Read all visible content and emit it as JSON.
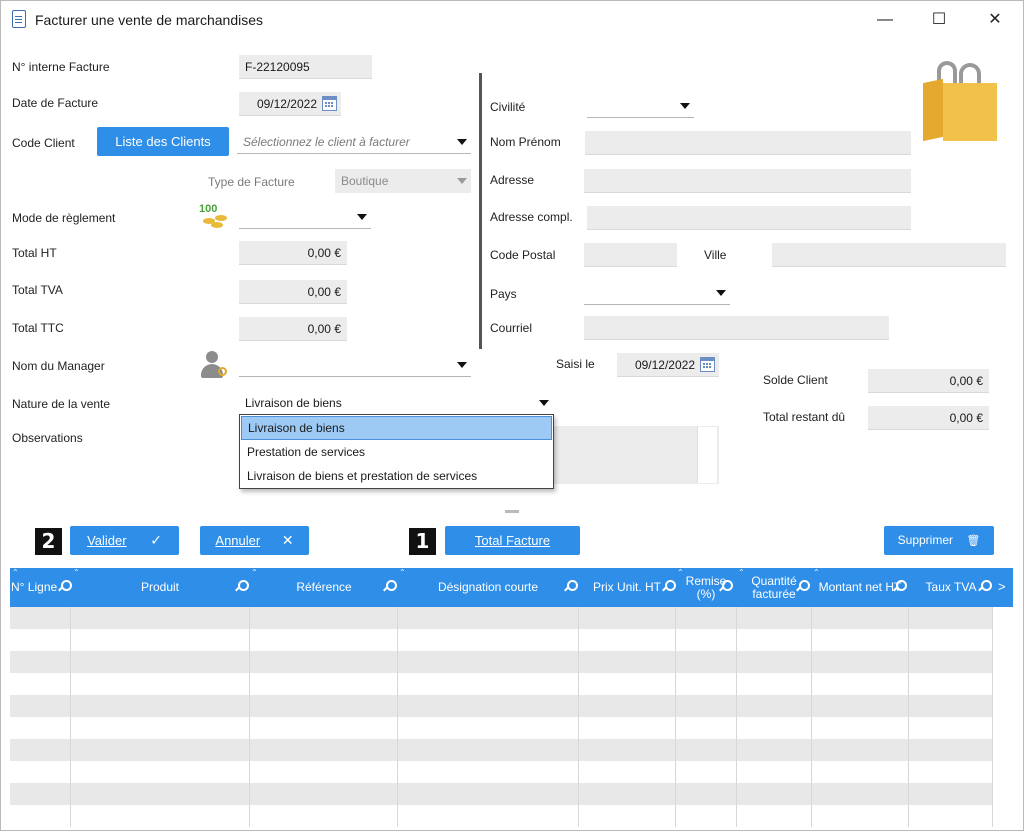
{
  "window": {
    "title": "Facturer une vente de marchandises",
    "minimize": "—",
    "maximize": "☐",
    "close": "✕"
  },
  "form": {
    "num_facture_label": "N° interne Facture",
    "num_facture_value": "F-22120095",
    "date_facture_label": "Date de Facture",
    "date_facture_value": "09/12/2022",
    "code_client_label": "Code Client",
    "liste_clients_button": "Liste des Clients",
    "client_placeholder": "Sélectionnez le client à facturer",
    "type_facture_label": "Type de Facture",
    "type_facture_value": "Boutique",
    "mode_reglement_label": "Mode de règlement",
    "mode_reglement_value": "",
    "total_ht_label": "Total HT",
    "total_ht_value": "0,00 €",
    "total_tva_label": "Total TVA",
    "total_tva_value": "0,00 €",
    "total_ttc_label": "Total TTC",
    "total_ttc_value": "0,00 €",
    "manager_label": "Nom du Manager",
    "manager_value": "",
    "nature_label": "Nature de la vente",
    "nature_value": "Livraison de biens",
    "observations_label": "Observations",
    "money_icon_text": "100"
  },
  "nature_options": [
    "Livraison de biens",
    "Prestation de services",
    "Livraison de biens et prestation de services"
  ],
  "client": {
    "civilite_label": "Civilité",
    "civilite_value": "",
    "nom_label": "Nom Prénom",
    "adresse_label": "Adresse",
    "adresse_compl_label": "Adresse compl.",
    "code_postal_label": "Code Postal",
    "ville_label": "Ville",
    "pays_label": "Pays",
    "pays_value": "",
    "courriel_label": "Courriel",
    "saisi_label": "Saisi le",
    "saisi_value": "09/12/2022",
    "solde_label": "Solde Client",
    "solde_value": "0,00 €",
    "restant_label": "Total restant dû",
    "restant_value": "0,00 €"
  },
  "actions": {
    "badge_2": "2",
    "valider": "Valider",
    "annuler": "Annuler",
    "badge_1": "1",
    "total_facture": "Total Facture",
    "supprimer": "Supprimer"
  },
  "grid": {
    "columns": [
      "N° Ligne",
      "Produit",
      "Référence",
      "Désignation courte",
      "Prix Unit. HT",
      "Remise (%)",
      "Quantité facturée",
      "Montant net HT",
      "Taux TVA"
    ],
    "more_indicator": ">"
  },
  "colors": {
    "accent": "#2e8ee8",
    "field_bg": "#ececec",
    "selection": "#9ccaf5",
    "bag": "#f2c14a"
  }
}
